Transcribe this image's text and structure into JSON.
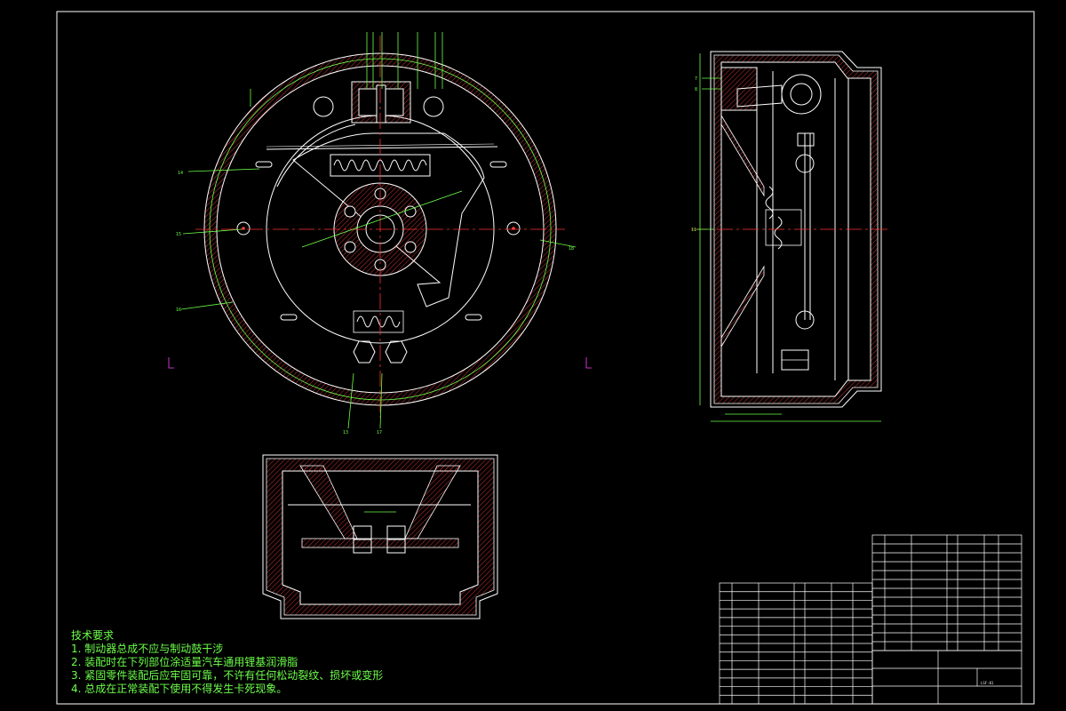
{
  "colors": {
    "background": "#000000",
    "frame": "#ffffff",
    "outline": "#ffffff",
    "dimension": "#6dff4a",
    "centerline": "#ff3030",
    "hatch": "#ff4040",
    "leader": "#ff40ff",
    "note_text": "#6dff4a"
  },
  "notes": {
    "title": "技术要求",
    "items": [
      "1. 制动器总成不应与制动鼓干涉",
      "2. 装配时在下列部位涂适量汽车通用锂基润滑脂",
      "3. 紧固零件装配后应牢固可靠，不许有任何松动裂纹、损坏或变形",
      "4. 总成在正常装配下使用不得发生卡死现象。"
    ]
  },
  "labels": {
    "front_left": [
      "14",
      "15",
      "16"
    ],
    "front_right": [
      "18"
    ],
    "front_bottom": [
      "13",
      "17"
    ],
    "side_left": [
      "7",
      "8",
      "11"
    ]
  },
  "title_block": {
    "drawing_no": "LSF-01"
  }
}
